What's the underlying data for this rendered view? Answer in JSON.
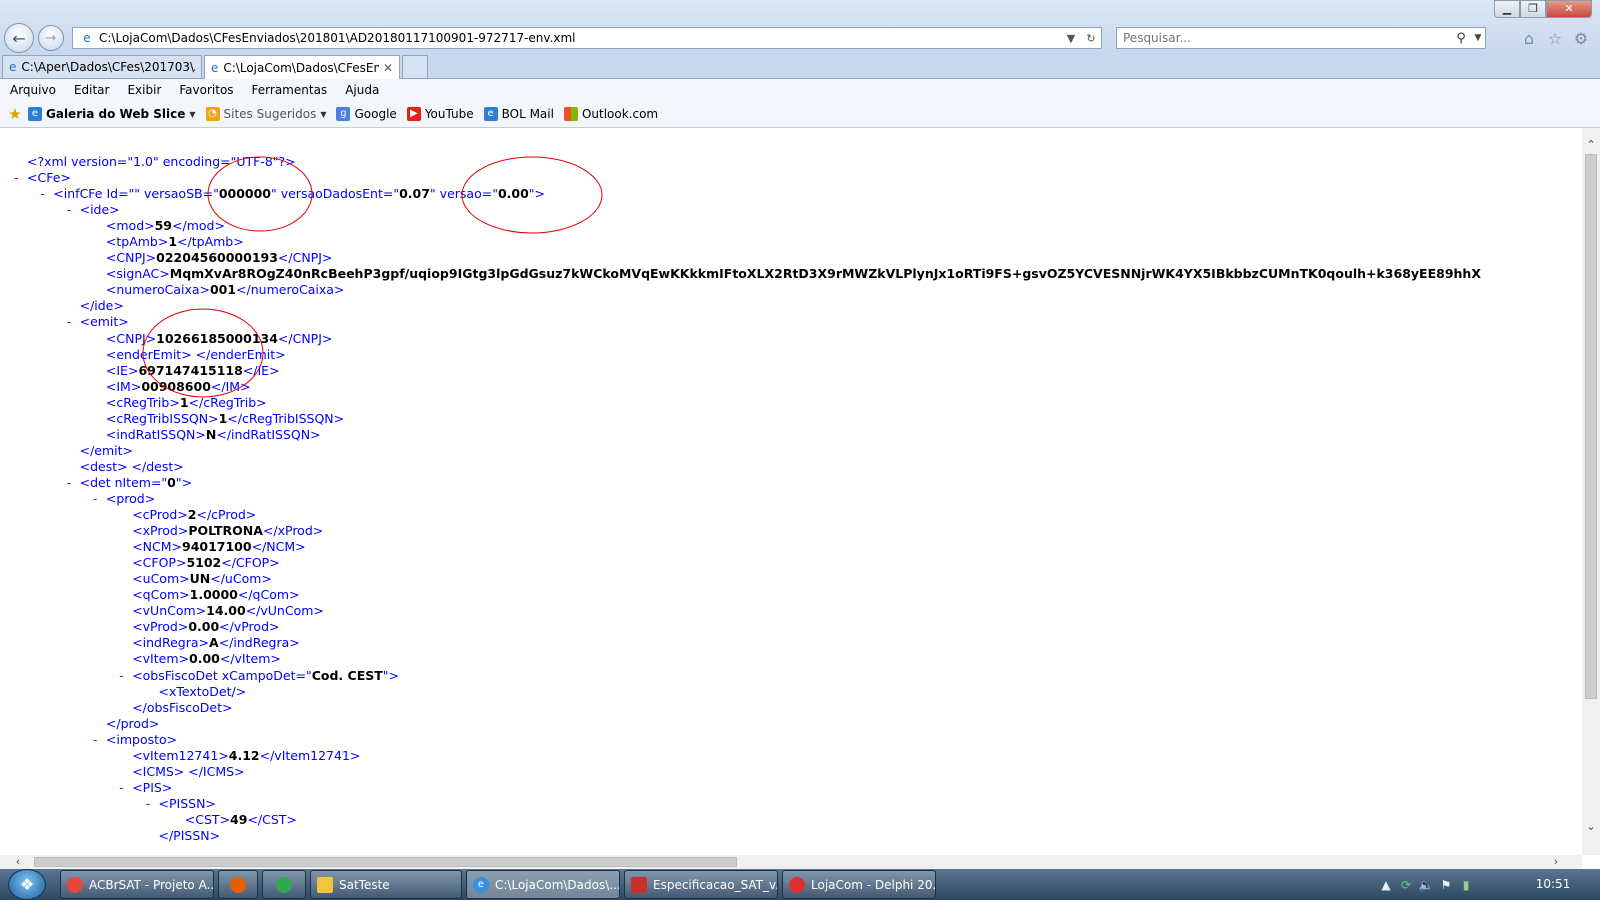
{
  "browser": {
    "address": "C:\\LojaCom\\Dados\\CFesEnviados\\201801\\AD20180117100901-972717-env.xml",
    "search_placeholder": "Pesquisar...",
    "tabs": [
      {
        "label": "C:\\Aper\\Dados\\CFes\\201703\\A..."
      },
      {
        "label": "C:\\LojaCom\\Dados\\CFesEn..."
      }
    ]
  },
  "menu": [
    "Arquivo",
    "Editar",
    "Exibir",
    "Favoritos",
    "Ferramentas",
    "Ajuda"
  ],
  "favorites": [
    "Galeria do Web Slice",
    "Sites Sugeridos",
    "Google",
    "YouTube",
    "BOL Mail",
    "Outlook.com"
  ],
  "xml": {
    "declaration": "<?xml version=\"1.0\" encoding=\"UTF-8\"?>",
    "lines": [
      {
        "indent": 0,
        "marker": "-",
        "open": "<CFe>",
        "value": "",
        "close": ""
      },
      {
        "indent": 1,
        "marker": "-",
        "open": "<infCFe Id=\"\" versaoSB=\"",
        "value": "000000",
        "close": "\" versaoDadosEnt=\"",
        "value2": "0.07",
        "close2": "\" versao=\"",
        "value3": "0.00",
        "close3": "\">"
      },
      {
        "indent": 2,
        "marker": "-",
        "open": "<ide>",
        "value": "",
        "close": ""
      },
      {
        "indent": 3,
        "marker": "",
        "open": "<mod>",
        "value": "59",
        "close": "</mod>"
      },
      {
        "indent": 3,
        "marker": "",
        "open": "<tpAmb>",
        "value": "1",
        "close": "</tpAmb>"
      },
      {
        "indent": 3,
        "marker": "",
        "open": "<CNPJ>",
        "value": "02204560000193",
        "close": "</CNPJ>"
      },
      {
        "indent": 3,
        "marker": "",
        "open": "<signAC>",
        "value": "MqmXvAr8ROgZ40nRcBeehP3gpf/uqiop9IGtg3lpGdGsuz7kWCkoMVqEwKKkkmIFtoXLX2RtD3X9rMWZkVLPlynJx1oRTi9FS+gsvOZ5YCVESNNjrWK4YX5IBkbbzCUMnTK0qoulh+k368yEE89hhX",
        "close": ""
      },
      {
        "indent": 3,
        "marker": "",
        "open": "<numeroCaixa>",
        "value": "001",
        "close": "</numeroCaixa>"
      },
      {
        "indent": 2,
        "marker": "",
        "open": "</ide>",
        "value": "",
        "close": ""
      },
      {
        "indent": 2,
        "marker": "-",
        "open": "<emit>",
        "value": "",
        "close": ""
      },
      {
        "indent": 3,
        "marker": "",
        "open": "<CNPJ>",
        "value": "10266185000134",
        "close": "</CNPJ>"
      },
      {
        "indent": 3,
        "marker": "",
        "open": "<enderEmit> </enderEmit>",
        "value": "",
        "close": ""
      },
      {
        "indent": 3,
        "marker": "",
        "open": "<IE>",
        "value": "697147415118",
        "close": "</IE>"
      },
      {
        "indent": 3,
        "marker": "",
        "open": "<IM>",
        "value": "00908600",
        "close": "</IM>"
      },
      {
        "indent": 3,
        "marker": "",
        "open": "<cRegTrib>",
        "value": "1",
        "close": "</cRegTrib>"
      },
      {
        "indent": 3,
        "marker": "",
        "open": "<cRegTribISSQN>",
        "value": "1",
        "close": "</cRegTribISSQN>"
      },
      {
        "indent": 3,
        "marker": "",
        "open": "<indRatISSQN>",
        "value": "N",
        "close": "</indRatISSQN>"
      },
      {
        "indent": 2,
        "marker": "",
        "open": "</emit>",
        "value": "",
        "close": ""
      },
      {
        "indent": 2,
        "marker": "",
        "open": "<dest> </dest>",
        "value": "",
        "close": ""
      },
      {
        "indent": 2,
        "marker": "-",
        "open": "<det nItem=\"",
        "value": "0",
        "close": "\">"
      },
      {
        "indent": 3,
        "marker": "-",
        "open": "<prod>",
        "value": "",
        "close": ""
      },
      {
        "indent": 4,
        "marker": "",
        "open": "<cProd>",
        "value": "2",
        "close": "</cProd>"
      },
      {
        "indent": 4,
        "marker": "",
        "open": "<xProd>",
        "value": "POLTRONA",
        "close": "</xProd>"
      },
      {
        "indent": 4,
        "marker": "",
        "open": "<NCM>",
        "value": "94017100",
        "close": "</NCM>"
      },
      {
        "indent": 4,
        "marker": "",
        "open": "<CFOP>",
        "value": "5102",
        "close": "</CFOP>"
      },
      {
        "indent": 4,
        "marker": "",
        "open": "<uCom>",
        "value": "UN",
        "close": "</uCom>"
      },
      {
        "indent": 4,
        "marker": "",
        "open": "<qCom>",
        "value": "1.0000",
        "close": "</qCom>"
      },
      {
        "indent": 4,
        "marker": "",
        "open": "<vUnCom>",
        "value": "14.00",
        "close": "</vUnCom>"
      },
      {
        "indent": 4,
        "marker": "",
        "open": "<vProd>",
        "value": "0.00",
        "close": "</vProd>"
      },
      {
        "indent": 4,
        "marker": "",
        "open": "<indRegra>",
        "value": "A",
        "close": "</indRegra>"
      },
      {
        "indent": 4,
        "marker": "",
        "open": "<vItem>",
        "value": "0.00",
        "close": "</vItem>"
      },
      {
        "indent": 4,
        "marker": "-",
        "open": "<obsFiscoDet xCampoDet=\"",
        "value": "Cod. CEST",
        "close": "\">"
      },
      {
        "indent": 5,
        "marker": "",
        "open": "<xTextoDet/>",
        "value": "",
        "close": ""
      },
      {
        "indent": 4,
        "marker": "",
        "open": "</obsFiscoDet>",
        "value": "",
        "close": ""
      },
      {
        "indent": 3,
        "marker": "",
        "open": "</prod>",
        "value": "",
        "close": ""
      },
      {
        "indent": 3,
        "marker": "-",
        "open": "<imposto>",
        "value": "",
        "close": ""
      },
      {
        "indent": 4,
        "marker": "",
        "open": "<vItem12741>",
        "value": "4.12",
        "close": "</vItem12741>"
      },
      {
        "indent": 4,
        "marker": "",
        "open": "<ICMS> </ICMS>",
        "value": "",
        "close": ""
      },
      {
        "indent": 4,
        "marker": "-",
        "open": "<PIS>",
        "value": "",
        "close": ""
      },
      {
        "indent": 5,
        "marker": "-",
        "open": "<PISSN>",
        "value": "",
        "close": ""
      },
      {
        "indent": 6,
        "marker": "",
        "open": "<CST>",
        "value": "49",
        "close": "</CST>"
      },
      {
        "indent": 5,
        "marker": "",
        "open": "</PISSN>",
        "value": "",
        "close": ""
      }
    ]
  },
  "taskbar": {
    "tasks": [
      "ACBrSAT - Projeto A...",
      "",
      "",
      "SatTeste",
      "C:\\LojaCom\\Dados\\...",
      "Especificacao_SAT_v...",
      "LojaCom - Delphi 20..."
    ],
    "clock": "10:51"
  },
  "colors": {
    "tag": "#0000ff",
    "marker": "#e00000",
    "annotation": "#e00000"
  }
}
